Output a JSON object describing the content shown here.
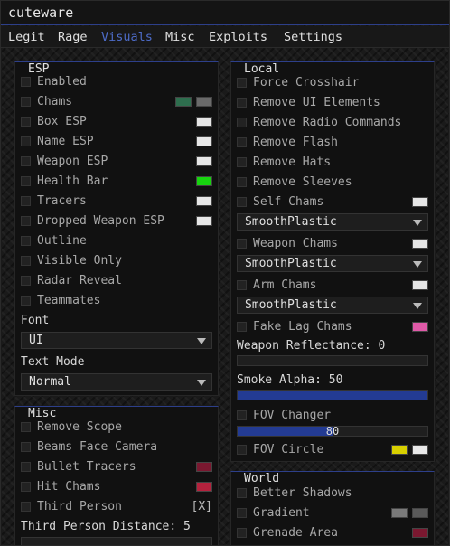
{
  "app_title": "cuteware",
  "menu": [
    "Legit",
    "Rage",
    "Visuals",
    "Misc",
    "Exploits",
    "Settings"
  ],
  "esp": {
    "title": "ESP",
    "items": [
      {
        "label": "Enabled"
      },
      {
        "label": "Chams",
        "colors": [
          "#2e6e4e",
          "#6a6a6a"
        ]
      },
      {
        "label": "Box ESP",
        "colors": [
          "#e6e6e6"
        ]
      },
      {
        "label": "Name ESP",
        "colors": [
          "#e6e6e6"
        ]
      },
      {
        "label": "Weapon ESP",
        "colors": [
          "#e6e6e6"
        ]
      },
      {
        "label": "Health Bar",
        "colors": [
          "#17d40f"
        ]
      },
      {
        "label": "Tracers",
        "colors": [
          "#e6e6e6"
        ]
      },
      {
        "label": "Dropped Weapon ESP",
        "colors": [
          "#e6e6e6"
        ]
      },
      {
        "label": "Outline"
      },
      {
        "label": "Visible Only"
      },
      {
        "label": "Radar Reveal"
      },
      {
        "label": "Teammates"
      }
    ],
    "font_label": "Font",
    "font_value": "UI",
    "text_mode_label": "Text Mode",
    "text_mode_value": "Normal"
  },
  "misc": {
    "title": "Misc",
    "items": [
      {
        "label": "Remove Scope"
      },
      {
        "label": "Beams Face Camera"
      },
      {
        "label": "Bullet Tracers",
        "colors": [
          "#7a1830"
        ]
      },
      {
        "label": "Hit Chams",
        "colors": [
          "#b3223d"
        ]
      },
      {
        "label": "Third Person",
        "keybind": "[X]"
      }
    ],
    "distance_label": "Third Person Distance: 5"
  },
  "local": {
    "title": "Local",
    "items": [
      {
        "label": "Force Crosshair"
      },
      {
        "label": "Remove UI Elements"
      },
      {
        "label": "Remove Radio Commands"
      },
      {
        "label": "Remove Flash"
      },
      {
        "label": "Remove Hats"
      },
      {
        "label": "Remove Sleeves"
      }
    ],
    "self_chams": {
      "label": "Self Chams",
      "color": "#e6e6e6",
      "material": "SmoothPlastic"
    },
    "weapon_chams": {
      "label": "Weapon Chams",
      "color": "#e6e6e6",
      "material": "SmoothPlastic"
    },
    "arm_chams": {
      "label": "Arm Chams",
      "color": "#e6e6e6",
      "material": "SmoothPlastic"
    },
    "fake_lag_chams": {
      "label": "Fake Lag Chams",
      "color": "#e05aa8"
    },
    "reflectance": {
      "label": "Weapon Reflectance: 0",
      "value": 0
    },
    "smoke": {
      "label": "Smoke Alpha: 50",
      "value": 1.0
    },
    "fov_changer": {
      "label": "FOV Changer",
      "value_text": "80",
      "value": 0.5
    },
    "fov_circle": {
      "label": "FOV Circle",
      "colors": [
        "#d8d000",
        "#e6e6e6"
      ]
    }
  },
  "world": {
    "title": "World",
    "items": [
      {
        "label": "Better Shadows"
      },
      {
        "label": "Gradient",
        "colors": [
          "#7a7a7a",
          "#5a5a5a"
        ]
      },
      {
        "label": "Grenade Area",
        "colors": [
          "#7a1830"
        ]
      }
    ]
  }
}
